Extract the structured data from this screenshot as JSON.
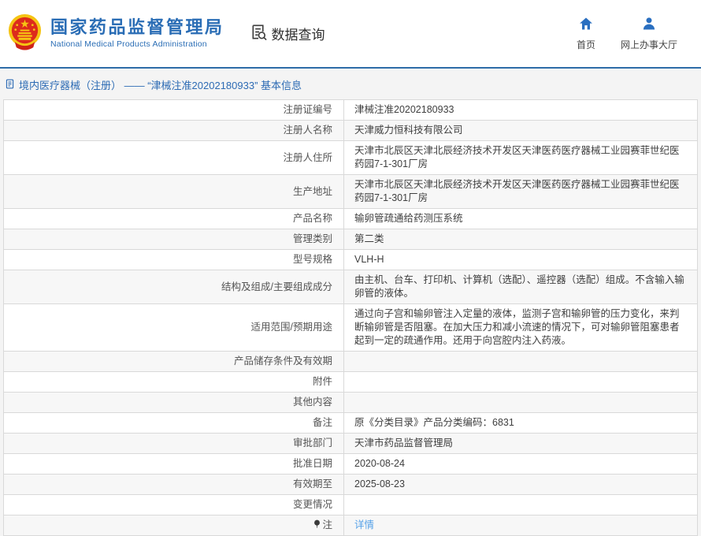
{
  "header": {
    "org_name_zh": "国家药品监督管理局",
    "org_name_en": "National Medical Products Administration",
    "section_label": "数据查询",
    "nav": {
      "home_label": "首页",
      "hall_label": "网上办事大厅"
    }
  },
  "breadcrumb": {
    "title": "境内医疗器械（注册） —— “津械注准20202180933” 基本信息"
  },
  "table": {
    "rows": [
      {
        "label": "注册证编号",
        "value": "津械注准20202180933"
      },
      {
        "label": "注册人名称",
        "value": "天津威力恒科技有限公司"
      },
      {
        "label": "注册人住所",
        "value": "天津市北辰区天津北辰经济技术开发区天津医药医疗器械工业园赛菲世纪医药园7-1-301厂房"
      },
      {
        "label": "生产地址",
        "value": "天津市北辰区天津北辰经济技术开发区天津医药医疗器械工业园赛菲世纪医药园7-1-301厂房"
      },
      {
        "label": "产品名称",
        "value": "输卵管疏通给药测压系统"
      },
      {
        "label": "管理类别",
        "value": "第二类"
      },
      {
        "label": "型号规格",
        "value": "VLH-H"
      },
      {
        "label": "结构及组成/主要组成成分",
        "value": "由主机、台车、打印机、计算机（选配）、遥控器（选配）组成。不含输入输卵管的液体。"
      },
      {
        "label": "适用范围/预期用途",
        "value": "通过向子宫和输卵管注入定量的液体，监测子宫和输卵管的压力变化，来判断输卵管是否阻塞。在加大压力和减小流速的情况下，可对输卵管阻塞患者起到一定的疏通作用。还用于向宫腔内注入药液。"
      },
      {
        "label": "产品储存条件及有效期",
        "value": ""
      },
      {
        "label": "附件",
        "value": ""
      },
      {
        "label": "其他内容",
        "value": ""
      },
      {
        "label": "备注",
        "value": "原《分类目录》产品分类编码：6831"
      },
      {
        "label": "审批部门",
        "value": "天津市药品监督管理局"
      },
      {
        "label": "批准日期",
        "value": "2020-08-24"
      },
      {
        "label": "有效期至",
        "value": "2025-08-23"
      },
      {
        "label": "变更情况",
        "value": ""
      },
      {
        "label": "注",
        "value": "详情",
        "is_link": true,
        "label_icon": "note-pin-icon"
      }
    ]
  },
  "colors": {
    "brand_blue": "#2a6db5",
    "divider_blue": "#2e6da8",
    "title_blue": "#2d6bb4",
    "link_blue": "#55a1e8",
    "emblem_red": "#dd2b1c",
    "emblem_gold": "#f5c413",
    "alt_row_bg": "#f7f7f7",
    "border_gray": "#d9d9d9"
  }
}
